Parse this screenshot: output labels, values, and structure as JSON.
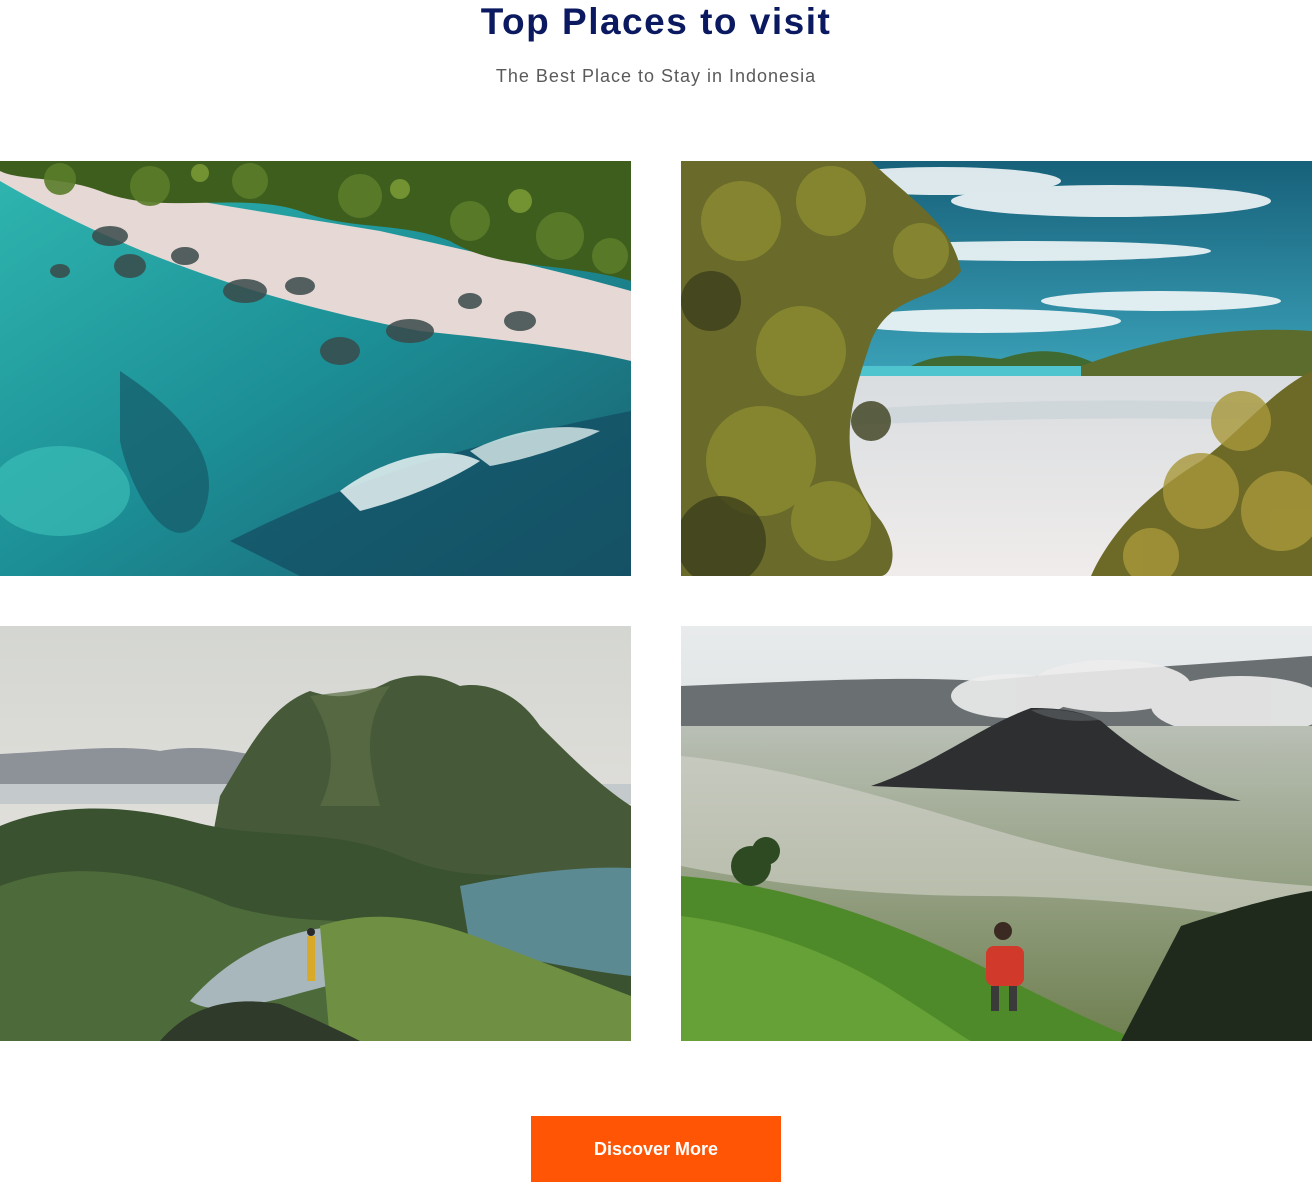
{
  "header": {
    "title": "Top Places to visit",
    "subtitle": "The Best Place to Stay in Indonesia"
  },
  "gallery": {
    "items": [
      {
        "icon": "aerial-beach-image"
      },
      {
        "icon": "tropical-beach-image"
      },
      {
        "icon": "mountain-hills-image"
      },
      {
        "icon": "volcano-landscape-image"
      }
    ]
  },
  "cta": {
    "label": "Discover More"
  },
  "colors": {
    "title": "#0b1a60",
    "subtitle": "#5a5a5a",
    "accent": "#ff5504",
    "background": "#ffffff"
  }
}
